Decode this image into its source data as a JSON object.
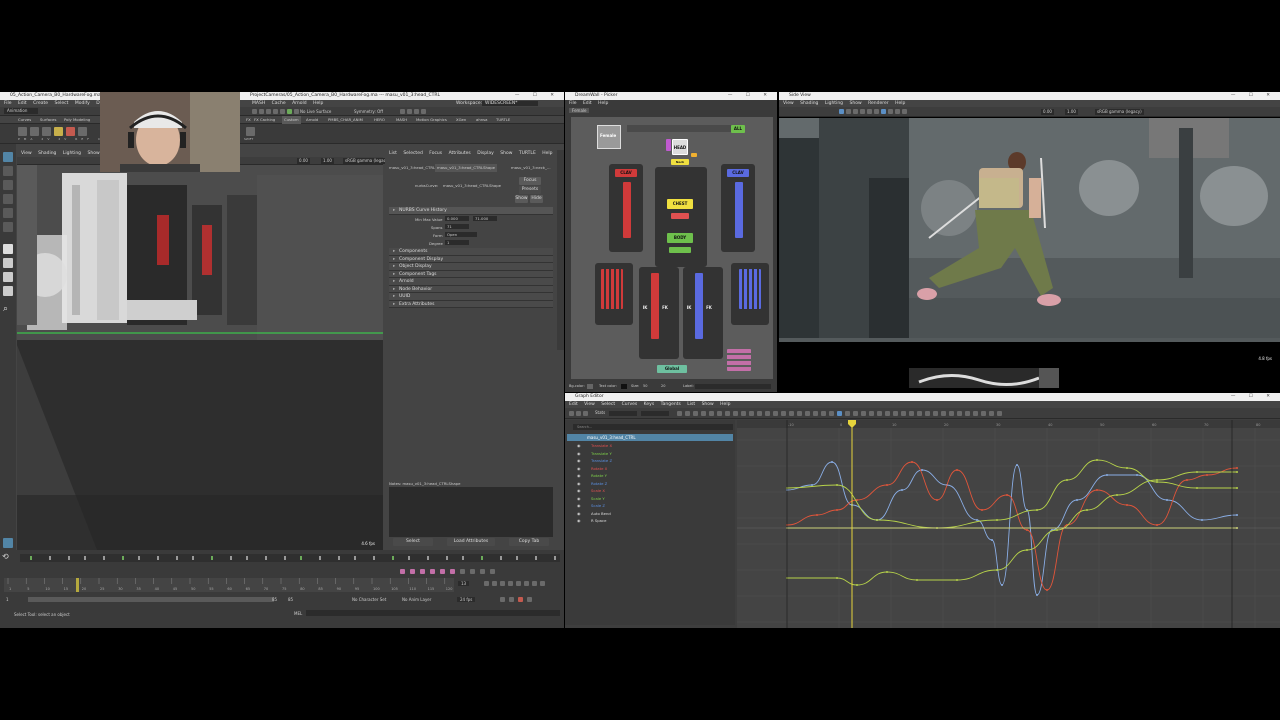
{
  "maya": {
    "title": "05_Action_Camera_B0_HardwareFog.ma* - Autodesk MAYA 2023",
    "title_path": "ProjectCameras/05_Action_Camera_B0_HardwareFog.ma  ---  masu_v01_3:head_CTRL",
    "menus": [
      "File",
      "Edit",
      "Create",
      "Select",
      "Modify",
      "Display",
      "Windows",
      "Arnold",
      "Help"
    ],
    "menus2": [
      "MASH",
      "Cache",
      "Arnold",
      "Help"
    ],
    "workspace_label": "Workspace:",
    "workspace_value": "WIDESCREEN*",
    "mode": "Animation",
    "shelf_tabs": [
      "Curves",
      "Surfaces",
      "Poly Modeling"
    ],
    "shelf_tabs2": [
      "FX",
      "FX Caching",
      "Custom",
      "Arnold",
      "PMBS_CHAR_ANIM",
      "HERO",
      "MASH",
      "Motion Graphics",
      "XGen",
      "ahnsa",
      "TURTLE"
    ],
    "live_surface": "No Live Surface",
    "symmetry": "Symmetry: Off",
    "viewport_menus": [
      "View",
      "Shading",
      "Lighting",
      "Show",
      "Renderer",
      "Panels"
    ],
    "gamma": "sRGB gamma (legacy)",
    "zero_val": "0.00",
    "one_val": "1.00",
    "fps": "4.6 fps",
    "timeline_numbers": [
      "1",
      "5",
      "10",
      "15",
      "20",
      "25",
      "30",
      "35",
      "40",
      "45",
      "50",
      "55",
      "60",
      "65",
      "70",
      "75",
      "80",
      "85",
      "90",
      "95",
      "100",
      "105",
      "110",
      "115",
      "120"
    ],
    "current_frame": "13",
    "range_start": "1",
    "range_end": "85",
    "range_end2": "85",
    "char_set": "No Character Set",
    "anim_layer": "No Anim Layer",
    "fps_setting": "24 fps",
    "mel_label": "MEL",
    "status": "Select Tool: select an object",
    "shelf_labels": [
      "PMA",
      "2V",
      "2V",
      "REF",
      "CRP",
      "DSP",
      "SWIFT"
    ]
  },
  "attr_editor": {
    "tabs": [
      "List",
      "Selected",
      "Focus",
      "Attributes",
      "Display",
      "Show",
      "TURTLE",
      "Help"
    ],
    "node_tabs": [
      "masu_v01_3:head_CTRL",
      "masu_v01_3:head_CTRLShape",
      "masu_v01_3:neck_..."
    ],
    "shape_label": "nurbsCurve:",
    "shape_value": "masu_v01_3:head_CTRLShape",
    "focus_btn": "Focus",
    "presets_btn": "Presets",
    "show_btn": "Show",
    "hide_btn": "Hide",
    "section_title": "NURBS Curve History",
    "min_max_label": "Min Max Value",
    "min_val": "0.000",
    "max_val": "71.000",
    "spans_label": "Spans",
    "spans_val": "71",
    "form_label": "Form",
    "form_val": "Open",
    "degree_label": "Degree",
    "degree_val": "1",
    "sections": [
      "Components",
      "Component Display",
      "Object Display",
      "Component Tags",
      "Arnold",
      "Node Behavior",
      "UUID",
      "Extra Attributes"
    ],
    "notes": "Notes: masu_v01_3:head_CTRLShape",
    "select_btn": "Select",
    "load_btn": "Load Attributes",
    "copy_btn": "Copy Tab"
  },
  "picker": {
    "title": "DreamWall - Picker",
    "menus": [
      "File",
      "Edit",
      "Help"
    ],
    "tab": "Female",
    "female_label": "Female",
    "all_btn": "ALL",
    "head": "HEAD",
    "chest": "CHEST",
    "body": "BODY",
    "clav_l": "CLAV",
    "clav_r": "CLAV",
    "ik_l": "IK",
    "fk_l": "FK",
    "ik_r": "IK",
    "fk_r": "FK",
    "neck": "Neck",
    "global": "Global",
    "bg_color": "Bg-color:",
    "text_color": "Text color:",
    "size": "Size:",
    "size_val1": "50",
    "size_val2": "20",
    "label": "Label:"
  },
  "side_view": {
    "title": "Side View",
    "menus": [
      "View",
      "Shading",
      "Lighting",
      "Show",
      "Renderer",
      "Help"
    ],
    "zero_val": "0.00",
    "one_val": "1.00",
    "gamma": "sRGB gamma (legacy)",
    "fps": "4.8 fps"
  },
  "graph_editor": {
    "title": "Graph Editor",
    "menus": [
      "Edit",
      "View",
      "Select",
      "Curves",
      "Keys",
      "Tangents",
      "List",
      "Show",
      "Help"
    ],
    "stats": "Stats",
    "search_placeholder": "Search...",
    "node": "masu_v01_3:head_CTRL",
    "channels": [
      {
        "name": "Translate X",
        "color": "#e05050"
      },
      {
        "name": "Translate Y",
        "color": "#7ecf4a"
      },
      {
        "name": "Translate Z",
        "color": "#5a8fe0"
      },
      {
        "name": "Rotate X",
        "color": "#e05050"
      },
      {
        "name": "Rotate Y",
        "color": "#7ecf4a"
      },
      {
        "name": "Rotate Z",
        "color": "#5a8fe0"
      },
      {
        "name": "Scale X",
        "color": "#e05050"
      },
      {
        "name": "Scale Y",
        "color": "#7ecf4a"
      },
      {
        "name": "Scale Z",
        "color": "#5a8fe0"
      },
      {
        "name": "Auto Bend",
        "color": "#dddddd"
      },
      {
        "name": "R Space",
        "color": "#dddddd"
      }
    ],
    "ruler": [
      "-10",
      "0",
      "10",
      "20",
      "30",
      "40",
      "50",
      "60",
      "70",
      "80"
    ]
  },
  "colors": {
    "maya_bg": "#444444",
    "accent_blue": "#5285a6",
    "curve_red": "#e0553a",
    "curve_green": "#b7d34a",
    "curve_blue": "#8aaee6",
    "playhead": "#e6d43c"
  }
}
